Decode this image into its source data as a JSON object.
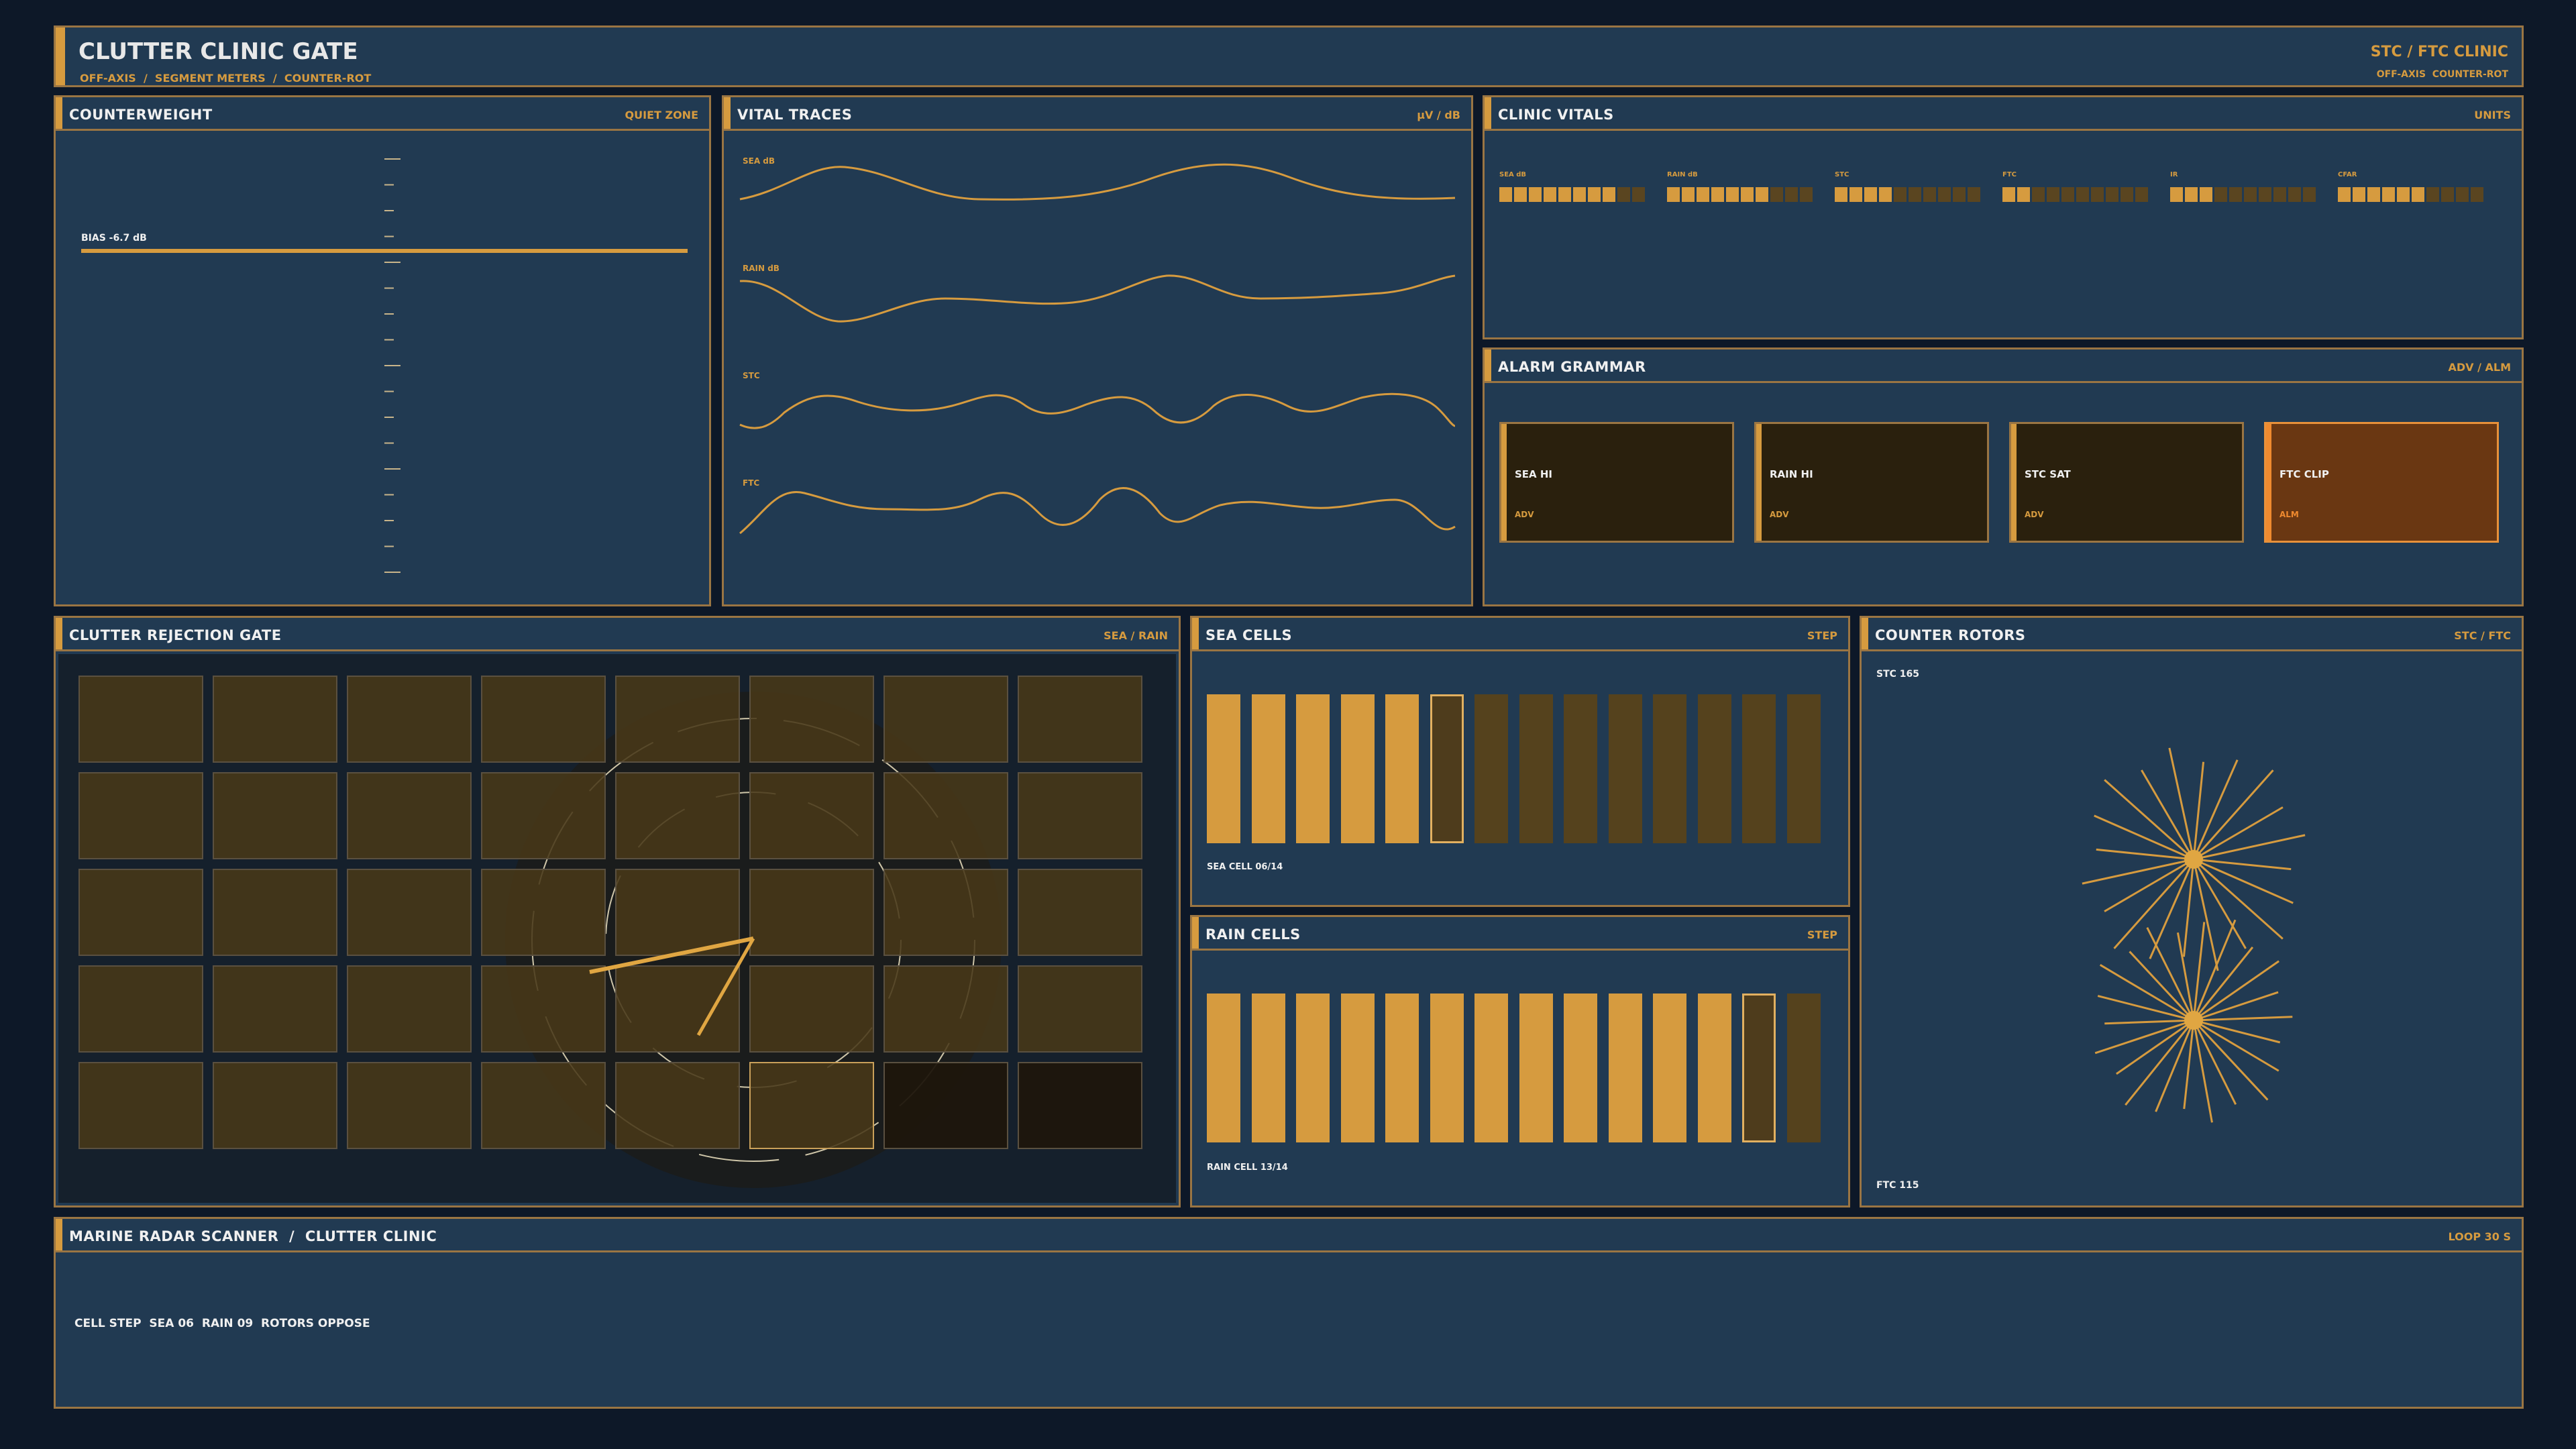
{
  "header": {
    "title": "CLUTTER CLINIC GATE",
    "subtitle": "OFF-AXIS  /  SEGMENT METERS  /  COUNTER-ROT",
    "right_title": "STC / FTC CLINIC",
    "right_sub": "OFF-AXIS  COUNTER-ROT"
  },
  "counterweight": {
    "title": "COUNTERWEIGHT",
    "tag": "QUIET ZONE",
    "bias_label": "BIAS -6.7 dB"
  },
  "vital_traces": {
    "title": "VITAL TRACES",
    "tag": "μV / dB",
    "traces": [
      "SEA dB",
      "RAIN dB",
      "STC",
      "FTC"
    ]
  },
  "clinic_vitals": {
    "title": "CLINIC VITALS",
    "tag": "UNITS",
    "meters": [
      {
        "label": "SEA dB",
        "level": 8,
        "of": 10
      },
      {
        "label": "RAIN dB",
        "level": 7,
        "of": 10
      },
      {
        "label": "STC",
        "level": 4,
        "of": 10
      },
      {
        "label": "FTC",
        "level": 2,
        "of": 10
      },
      {
        "label": "IR",
        "level": 3,
        "of": 10
      },
      {
        "label": "CFAR",
        "level": 6,
        "of": 10
      }
    ]
  },
  "alarm_grammar": {
    "title": "ALARM GRAMMAR",
    "tag": "ADV / ALM",
    "alarms": [
      {
        "name": "SEA HI",
        "level": "ADV"
      },
      {
        "name": "RAIN HI",
        "level": "ADV"
      },
      {
        "name": "STC SAT",
        "level": "ADV"
      },
      {
        "name": "FTC CLIP",
        "level": "ALM"
      }
    ]
  },
  "rejection_gate": {
    "title": "CLUTTER REJECTION GATE",
    "tag": "SEA / RAIN"
  },
  "sea_cells": {
    "title": "SEA CELLS",
    "tag": "STEP",
    "caption": "SEA CELL 06/14",
    "current": 6,
    "total": 14
  },
  "rain_cells": {
    "title": "RAIN CELLS",
    "tag": "STEP",
    "caption": "RAIN CELL 13/14",
    "current": 13,
    "total": 14
  },
  "counter_rotors": {
    "title": "COUNTER ROTORS",
    "tag": "STC / FTC",
    "top_label": "STC 165",
    "bottom_label": "FTC 115"
  },
  "footer": {
    "title": "MARINE RADAR SCANNER  /  CLUTTER CLINIC",
    "tag": "LOOP 30 S",
    "status": "CELL STEP  SEA 06  RAIN 09  ROTORS OPPOSE"
  },
  "colors": {
    "accent": "#d69b3f",
    "panel": "#213a52",
    "border": "#9a7543",
    "alarm": "#6a3712"
  }
}
